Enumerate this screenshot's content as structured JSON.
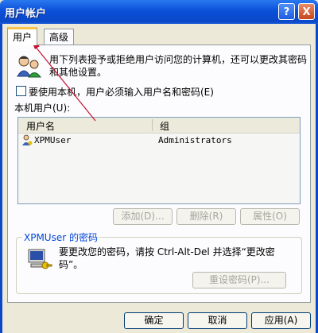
{
  "window": {
    "title": "用户帐户"
  },
  "title_buttons": {
    "help": "?",
    "close": "X"
  },
  "tabs": [
    {
      "label": "用户"
    },
    {
      "label": "高级"
    }
  ],
  "intro": {
    "text": "用下列表授予或拒绝用户访问您的计算机，还可以更改其密码和其他设置。"
  },
  "require_login": {
    "label": "要使用本机，用户必须输入用户名和密码(E)",
    "checked": false
  },
  "users_list": {
    "label": "本机用户(U):",
    "columns": [
      "用户名",
      "组"
    ],
    "rows": [
      {
        "name": "XPMUser",
        "group": "Administrators"
      }
    ]
  },
  "list_buttons": {
    "add": "添加(D)...",
    "remove": "删除(R)",
    "properties": "属性(O)"
  },
  "password_group": {
    "title": "XPMUser 的密码",
    "text": "要更改您的密码，请按 Ctrl-Alt-Del 并选择“更改密码”。",
    "reset_label": "重设密码(P)..."
  },
  "dialog_buttons": {
    "ok": "确定",
    "cancel": "取消",
    "apply": "应用(A)"
  },
  "colors": {
    "titlebar": "#0a48c8",
    "annotation_arrow": "#c8102e",
    "tab_highlight": "#f7c34a"
  }
}
